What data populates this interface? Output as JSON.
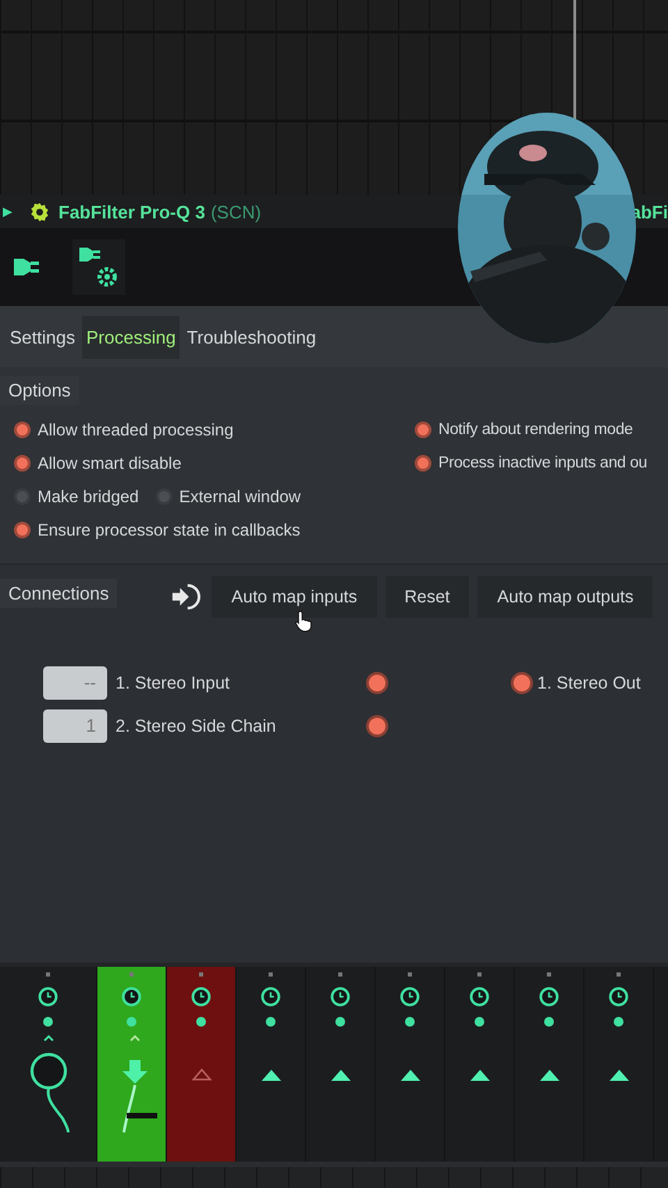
{
  "plugin_window": {
    "arrow": "▶",
    "title": "FabFilter Pro-Q 3",
    "subtitle": "(SCN)",
    "other_title": "abFi"
  },
  "tabs": [
    {
      "label": "Settings",
      "selected": false
    },
    {
      "label": "Processing",
      "selected": true
    },
    {
      "label": "Troubleshooting",
      "selected": false
    }
  ],
  "options": {
    "heading": "Options",
    "left": [
      [
        {
          "label": "Allow threaded processing",
          "checked": true
        }
      ],
      [
        {
          "label": "Allow smart disable",
          "checked": true
        }
      ],
      [
        {
          "label": "Make bridged",
          "checked": false
        },
        {
          "label": "External window",
          "checked": false
        }
      ],
      [
        {
          "label": "Ensure processor state in callbacks",
          "checked": true
        }
      ]
    ],
    "right": [
      {
        "label": "Notify about rendering mode",
        "checked": true
      },
      {
        "label": "Process inactive inputs and ou",
        "checked": true
      }
    ]
  },
  "connections": {
    "heading": "Connections",
    "buttons": [
      "Auto map inputs",
      "Reset",
      "Auto map outputs"
    ],
    "inputs": [
      {
        "value": "--",
        "label": "1. Stereo Input",
        "linked": true
      },
      {
        "value": "1",
        "label": "2. Stereo Side Chain",
        "linked": true
      }
    ],
    "outputs": [
      {
        "label": "1. Stereo Out",
        "linked": true
      }
    ]
  },
  "mixer": {
    "strips": [
      {
        "kind": "knob",
        "color": "#1c1d1f"
      },
      {
        "kind": "route",
        "color": "#2fa81e"
      },
      {
        "kind": "dim",
        "color": "#6e1010"
      },
      {
        "kind": "arrow",
        "color": "#1c1d1f"
      },
      {
        "kind": "arrow",
        "color": "#1c1d1f"
      },
      {
        "kind": "arrow",
        "color": "#1c1d1f"
      },
      {
        "kind": "arrow",
        "color": "#1c1d1f"
      },
      {
        "kind": "arrow",
        "color": "#1c1d1f"
      },
      {
        "kind": "arrow",
        "color": "#1c1d1f"
      }
    ]
  }
}
